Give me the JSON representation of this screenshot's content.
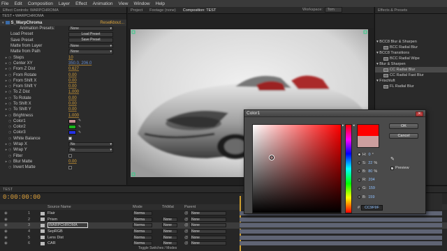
{
  "menubar": {
    "items": [
      "File",
      "Edit",
      "Composition",
      "Layer",
      "Effect",
      "Animation",
      "View",
      "Window",
      "Help"
    ]
  },
  "effect_controls": {
    "tab_label": "Effect Controls: WARPCHROMA",
    "breadcrumb": "TEST • WARPCHROMA",
    "effect_name": "S_WarpChroma",
    "reset_label": "Reset",
    "about_label": "About...",
    "animation_presets_label": "Animation Presets:",
    "animation_presets_value": "None",
    "load_preset_label": "Load Preset",
    "load_preset_button": "Load Preset",
    "save_preset_label": "Save Preset",
    "save_preset_button": "Save Preset",
    "matte_from_layer_label": "Matte from Layer",
    "matte_from_layer_value": "None",
    "matte_from_path_label": "Matte from Path",
    "matte_from_path_value": "None",
    "params": [
      {
        "label": "Steps",
        "value": "10"
      },
      {
        "label": "Center XY",
        "value": "350.0, 206.0"
      },
      {
        "label": "From Z Dist",
        "value": "0.627"
      },
      {
        "label": "From Rotate",
        "value": "0.00"
      },
      {
        "label": "From Shift X",
        "value": "0.00"
      },
      {
        "label": "From Shift Y",
        "value": "0.00"
      },
      {
        "label": "To Z Dist",
        "value": "1.000"
      },
      {
        "label": "To Rotate",
        "value": "0.00"
      },
      {
        "label": "To Shift X",
        "value": "0.00"
      },
      {
        "label": "To Shift Y",
        "value": "0.00"
      },
      {
        "label": "Brightness",
        "value": "1.000"
      }
    ],
    "colors": [
      {
        "label": "Color1",
        "hex": "#c98f98"
      },
      {
        "label": "Color2",
        "hex": "#19b51b"
      },
      {
        "label": "Color3",
        "hex": "#2431e6"
      }
    ],
    "white_balance_label": "White Balance",
    "wrap_x_label": "Wrap X",
    "wrap_x_value": "No",
    "wrap_y_label": "Wrap Y",
    "wrap_y_value": "No",
    "filter_label": "Filter",
    "blur_matte_label": "Blur Matte",
    "blur_matte_value": "0.00",
    "invert_matte_label": "Invert Matte"
  },
  "comp_panel": {
    "tabs": [
      "Project",
      "Footage (none)",
      "Composition: TEST"
    ],
    "workspace_label": "Workspace:",
    "workspace_value": "Tom"
  },
  "effects_panel": {
    "tab_label": "Effects & Presets",
    "items": [
      {
        "kind": "cat",
        "label": "▾ BCC8 Blur & Sharpen"
      },
      {
        "kind": "sub",
        "label": "BCC Radial Blur"
      },
      {
        "kind": "cat",
        "label": "▾ BCC8 Transitions"
      },
      {
        "kind": "sub",
        "label": "BCC Radial Wipe"
      },
      {
        "kind": "cat",
        "label": "▾ Blur & Sharpen"
      },
      {
        "kind": "sub",
        "label": "CC Radial Blur",
        "selected": true
      },
      {
        "kind": "sub",
        "label": "CC Radial Fast Blur"
      },
      {
        "kind": "cat",
        "label": "▾ Frischluft"
      },
      {
        "kind": "sub",
        "label": "FL Radial Blur"
      }
    ]
  },
  "timeline": {
    "timecode": "0:00:00:00",
    "tab_label": "TEST",
    "headers": {
      "source_name": "Source Name",
      "mode": "Mode",
      "trkmat": "TrkMat",
      "parent": "Parent"
    },
    "layers": [
      {
        "num": "1",
        "name": "Flair",
        "mode": "Norma",
        "trkmat": "",
        "parent": "None",
        "selected": false
      },
      {
        "num": "2",
        "name": "Prism",
        "mode": "Norma",
        "trkmat": "None",
        "parent": "None",
        "selected": false
      },
      {
        "num": "3",
        "name": "WARPCHROMA",
        "mode": "Norma",
        "trkmat": "None",
        "parent": "None",
        "selected": true
      },
      {
        "num": "4",
        "name": "SepRGB",
        "mode": "Norma",
        "trkmat": "None",
        "parent": "None",
        "selected": false
      },
      {
        "num": "5",
        "name": "Lens Dist",
        "mode": "Norma",
        "trkmat": "None",
        "parent": "None",
        "selected": false
      },
      {
        "num": "6",
        "name": "CAR",
        "mode": "Norma",
        "trkmat": "None",
        "parent": "None",
        "selected": false
      }
    ],
    "toggle_label": "Toggle Switches / Modes"
  },
  "color_dialog": {
    "title": "Color1",
    "ok_label": "OK",
    "cancel_label": "Cancel",
    "preview_label": "Preview",
    "hex_value": "CC9F9F",
    "new_color": "#ff0000",
    "old_color": "#cc9f9f",
    "picker_hue_hex": "#ff0000",
    "fields": [
      {
        "key": "H",
        "value": "0",
        "unit": "°",
        "selected": true
      },
      {
        "key": "S",
        "value": "22",
        "unit": "%",
        "selected": false
      },
      {
        "key": "B",
        "value": "80",
        "unit": "%",
        "selected": false
      },
      {
        "key": "R",
        "value": "204",
        "unit": "",
        "selected": false
      },
      {
        "key": "G",
        "value": "159",
        "unit": "",
        "selected": false
      },
      {
        "key": "B",
        "value": "159",
        "unit": "",
        "selected": false
      }
    ]
  }
}
